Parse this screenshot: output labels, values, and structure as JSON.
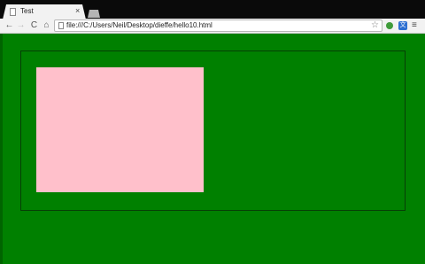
{
  "tab": {
    "title": "Test",
    "close_glyph": "×",
    "favicon": "page-icon"
  },
  "toolbar": {
    "back_glyph": "←",
    "forward_glyph": "→",
    "reload_glyph": "C",
    "home_glyph": "⌂",
    "url": "file:///C:/Users/Neil/Desktop/dieffe/hello10.html",
    "bookmark_glyph": "☆",
    "extension_blue_glyph": "文",
    "menu_glyph": "≡"
  },
  "colors": {
    "page_background": "#008000",
    "inner_box": "#ffc0cb",
    "outer_box_border": "#063f06"
  }
}
